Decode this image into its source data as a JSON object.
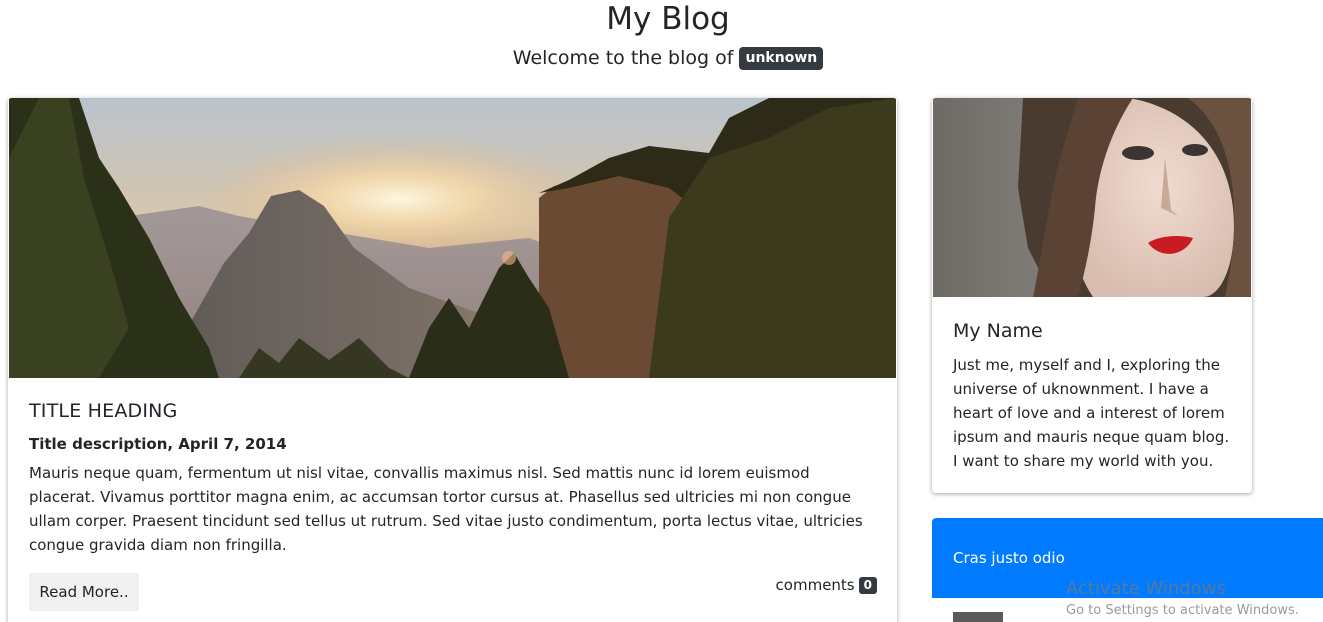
{
  "header": {
    "title": "My Blog",
    "subtitle": "Welcome to the blog of",
    "user_badge": "unknown"
  },
  "post": {
    "image_alt": "mountain sunset",
    "title": "TITLE HEADING",
    "description": "Title description, April 7, 2014",
    "body": "Mauris neque quam, fermentum ut nisl vitae, convallis maximus nisl. Sed mattis nunc id lorem euismod placerat. Vivamus porttitor magna enim, ac accumsan tortor cursus at. Phasellus sed ultricies mi non congue ullam corper. Praesent tincidunt sed tellus ut rutrum. Sed vitae justo condimentum, porta lectus vitae, ultricies congue gravida diam non fringilla.",
    "read_more_label": "Read More..",
    "comments_label": "comments",
    "comments_count": "0"
  },
  "profile": {
    "name": "My Name",
    "bio": "Just me, myself and I, exploring the universe of uknownment. I have a heart of love and a interest of lorem ipsum and mauris neque quam blog. I want to share my world with you."
  },
  "side_card": {
    "title": "Cras justo odio"
  },
  "os_overlay": {
    "title": "Activate Windows",
    "subtitle": "Go to Settings to activate Windows."
  },
  "colors": {
    "primary": "#007bff",
    "badge_dark": "#343a40",
    "button_bg": "#f1f1f1"
  }
}
